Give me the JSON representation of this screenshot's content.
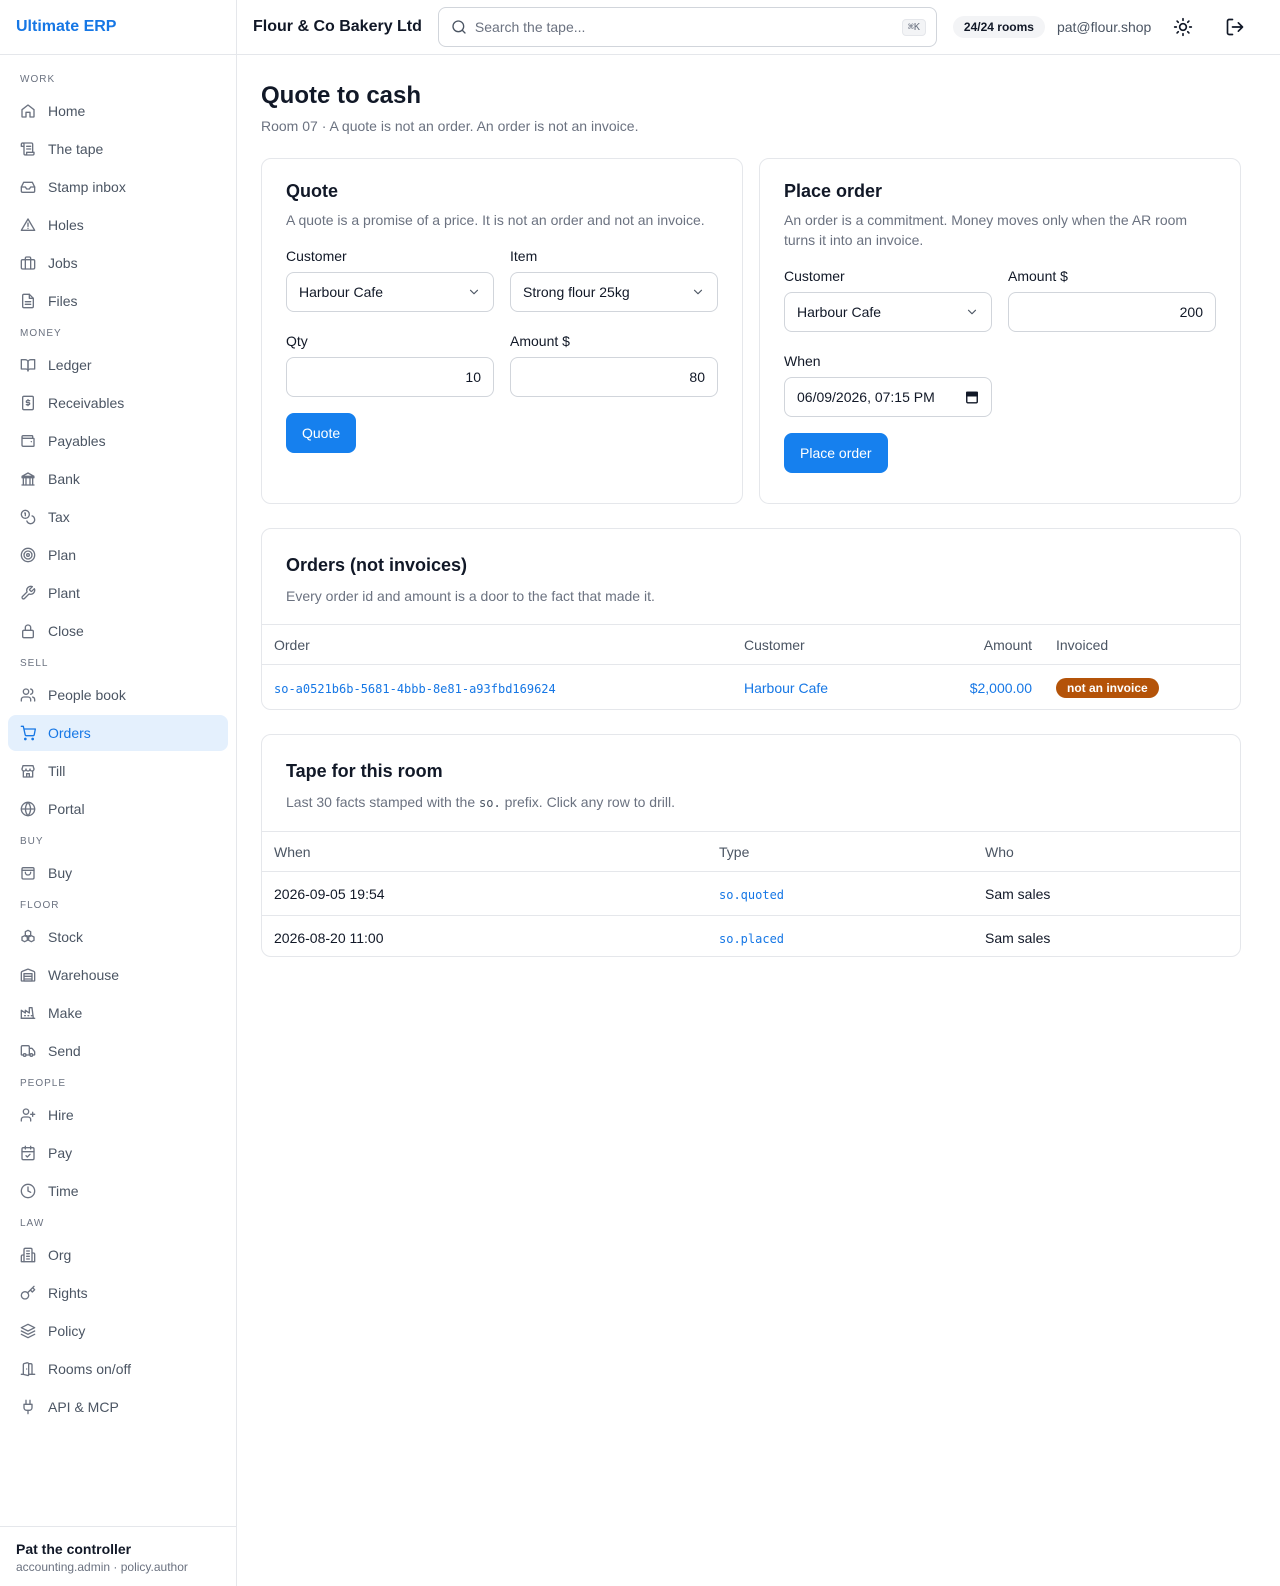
{
  "app": {
    "brand": "Ultimate ERP"
  },
  "topbar": {
    "company": "Flour & Co Bakery Ltd",
    "search_placeholder": "Search the tape...",
    "search_shortcut": "⌘K",
    "rooms": "24/24 rooms",
    "user_email": "pat@flour.shop"
  },
  "sidebar": {
    "sections": {
      "work": "WORK",
      "money": "MONEY",
      "sell": "SELL",
      "buy": "BUY",
      "floor": "FLOOR",
      "people": "PEOPLE",
      "law": "LAW"
    },
    "items": {
      "home": "Home",
      "tape": "The tape",
      "stamp_inbox": "Stamp inbox",
      "holes": "Holes",
      "jobs": "Jobs",
      "files": "Files",
      "ledger": "Ledger",
      "receivables": "Receivables",
      "payables": "Payables",
      "bank": "Bank",
      "tax": "Tax",
      "plan": "Plan",
      "plant": "Plant",
      "close": "Close",
      "people_book": "People book",
      "orders": "Orders",
      "till": "Till",
      "portal": "Portal",
      "buy": "Buy",
      "stock": "Stock",
      "warehouse": "Warehouse",
      "make": "Make",
      "send": "Send",
      "hire": "Hire",
      "pay": "Pay",
      "time": "Time",
      "org": "Org",
      "rights": "Rights",
      "policy": "Policy",
      "rooms_onoff": "Rooms on/off",
      "api_mcp": "API & MCP"
    },
    "user": {
      "name": "Pat the controller",
      "roles": "accounting.admin · policy.author"
    }
  },
  "page": {
    "title": "Quote to cash",
    "subtitle": "Room 07 · A quote is not an order. An order is not an invoice."
  },
  "quote": {
    "title": "Quote",
    "desc": "A quote is a promise of a price. It is not an order and not an invoice.",
    "customer_label": "Customer",
    "customer_value": "Harbour Cafe",
    "item_label": "Item",
    "item_value": "Strong flour 25kg",
    "qty_label": "Qty",
    "qty_value": "10",
    "amount_label": "Amount $",
    "amount_value": "80",
    "button": "Quote"
  },
  "place_order": {
    "title": "Place order",
    "desc": "An order is a commitment. Money moves only when the AR room turns it into an invoice.",
    "customer_label": "Customer",
    "customer_value": "Harbour Cafe",
    "amount_label": "Amount $",
    "amount_value": "200",
    "when_label": "When",
    "when_value": "06/09/2026, 07:15 PM",
    "button": "Place order"
  },
  "orders": {
    "title": "Orders (not invoices)",
    "desc": "Every order id and amount is a door to the fact that made it.",
    "columns": {
      "order": "Order",
      "customer": "Customer",
      "amount": "Amount",
      "invoiced": "Invoiced"
    },
    "rows": [
      {
        "id": "so-a0521b6b-5681-4bbb-8e81-a93fbd169624",
        "customer": "Harbour Cafe",
        "amount": "$2,000.00",
        "invoiced": "not an invoice"
      }
    ]
  },
  "tape": {
    "title": "Tape for this room",
    "desc_before": "Last 30 facts stamped with the ",
    "desc_code": "so.",
    "desc_after": " prefix. Click any row to drill.",
    "columns": {
      "when": "When",
      "type": "Type",
      "who": "Who"
    },
    "rows": [
      {
        "when": "2026-09-05 19:54",
        "type": "so.quoted",
        "who": "Sam sales"
      },
      {
        "when": "2026-08-20 11:00",
        "type": "so.placed",
        "who": "Sam sales"
      }
    ]
  },
  "colors": {
    "accent": "#1677e5",
    "button": "#1680ee",
    "badge": "#b45309",
    "active_bg": "#e4f0fd"
  }
}
